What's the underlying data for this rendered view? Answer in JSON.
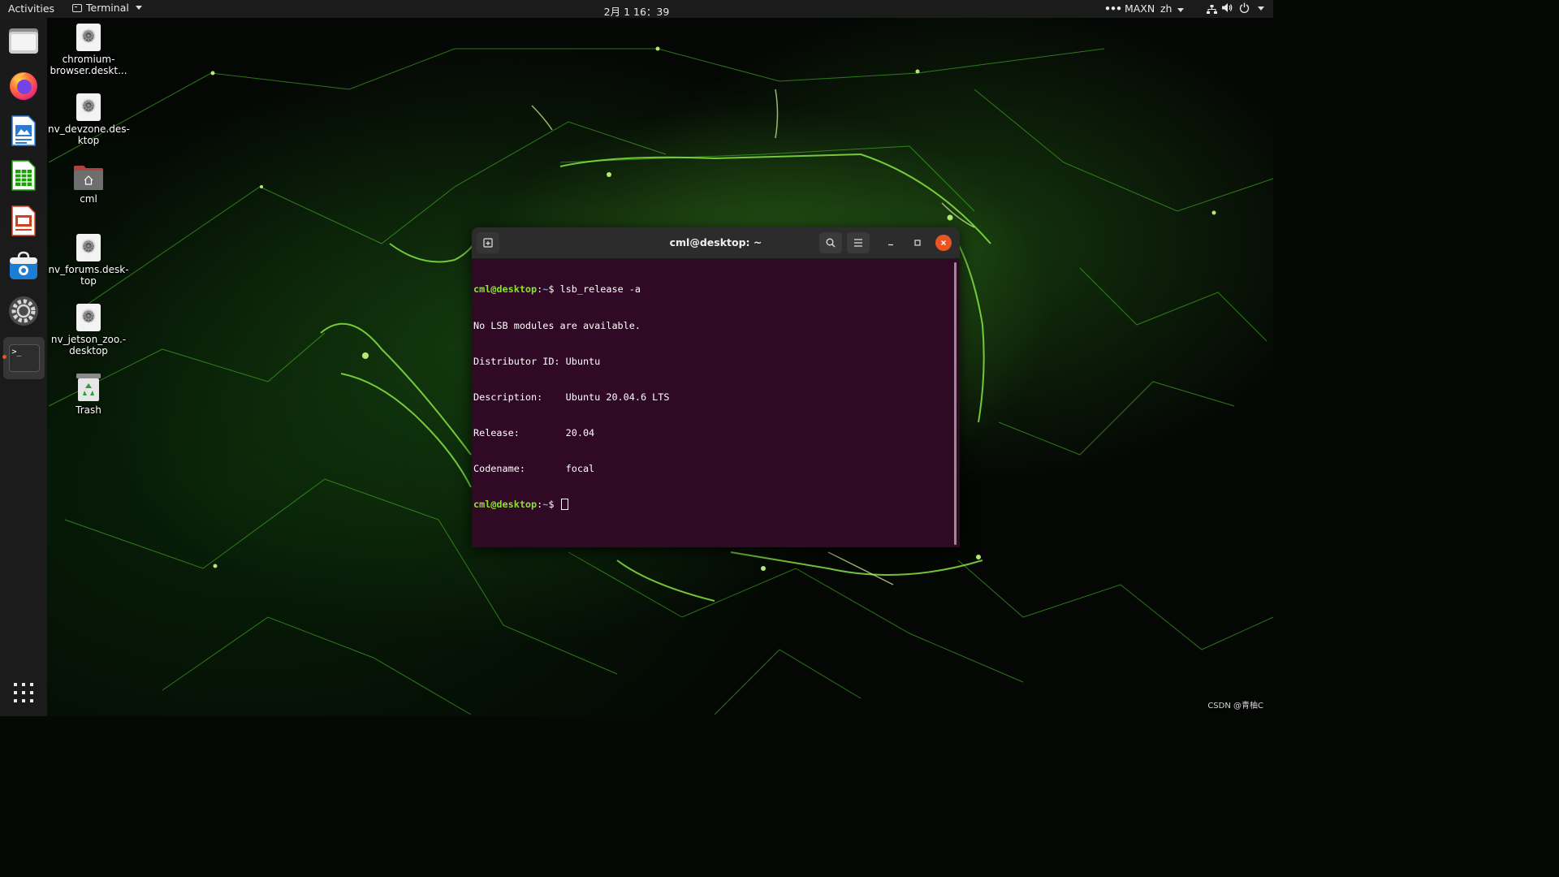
{
  "topbar": {
    "activities": "Activities",
    "app_name": "Terminal",
    "clock": "2月 1  16：39",
    "power_mode": "MAXN",
    "language": "zh",
    "network_icon": "network-wired-icon",
    "volume_icon": "volume-icon",
    "power_icon": "power-icon"
  },
  "dock": {
    "items": [
      {
        "name": "Files",
        "icon": "folder-icon"
      },
      {
        "name": "Firefox",
        "icon": "firefox-icon"
      },
      {
        "name": "LibreOffice Writer",
        "icon": "writer-icon"
      },
      {
        "name": "LibreOffice Calc",
        "icon": "calc-icon"
      },
      {
        "name": "LibreOffice Impress",
        "icon": "impress-icon"
      },
      {
        "name": "Ubuntu Software",
        "icon": "software-store-icon"
      },
      {
        "name": "Settings",
        "icon": "settings-icon"
      },
      {
        "name": "Terminal",
        "icon": "terminal-icon",
        "running": true
      },
      {
        "name": "Show Applications",
        "icon": "app-grid-icon"
      }
    ],
    "terminal_glyph": ">_"
  },
  "desktop": {
    "icons": [
      {
        "label_line1": "chromium-",
        "label_line2": "browser.deskt..."
      },
      {
        "label_line1": "nv_devzone.des-",
        "label_line2": "ktop"
      },
      {
        "label_line1": "cml",
        "label_line2": ""
      },
      {
        "label_line1": "nv_forums.desk-",
        "label_line2": "top"
      },
      {
        "label_line1": "nv_jetson_zoo.-",
        "label_line2": "desktop"
      },
      {
        "label_line1": "Trash",
        "label_line2": ""
      }
    ]
  },
  "terminal": {
    "title": "cml@desktop: ~",
    "prompt_user": "cml@desktop",
    "prompt_sep": ":",
    "prompt_path": "~",
    "prompt_symbol": "$ ",
    "command": "lsb_release -a",
    "output": [
      "No LSB modules are available.",
      "Distributor ID:\tUbuntu",
      "Description:\tUbuntu 20.04.6 LTS",
      "Release:\t20.04",
      "Codename:\tfocal"
    ],
    "output_display": [
      "No LSB modules are available.",
      "Distributor ID: Ubuntu",
      "Description:    Ubuntu 20.04.6 LTS",
      "Release:        20.04",
      "Codename:       focal"
    ]
  },
  "watermark": "CSDN @青柚C",
  "colors": {
    "topbar_bg": "#1b1b1b",
    "terminal_bg": "#300a24",
    "prompt_user": "#8ae234",
    "prompt_path": "#729fcf",
    "close_button": "#e95420",
    "wallpaper_accent": "#76b900"
  }
}
